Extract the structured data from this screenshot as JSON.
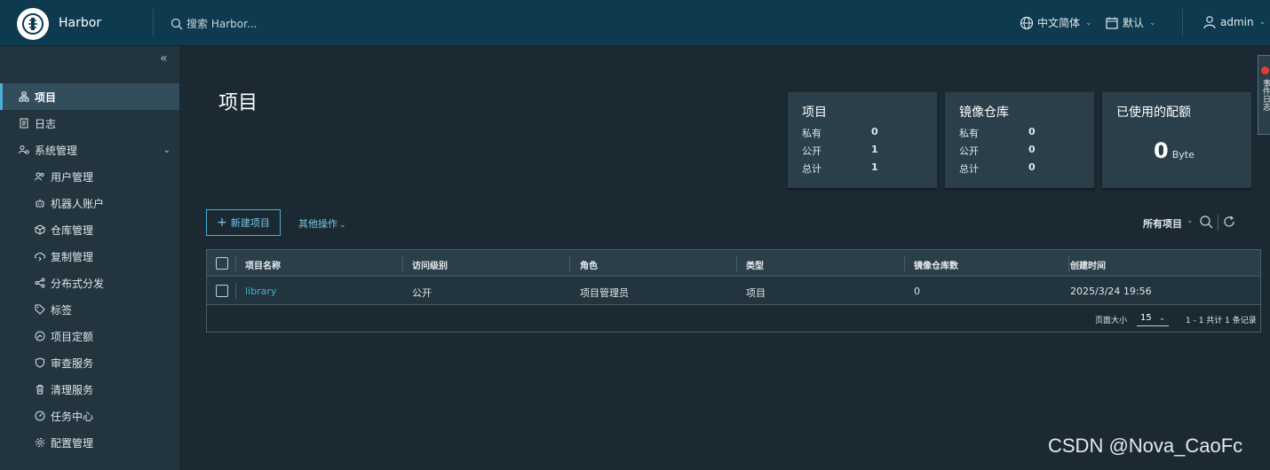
{
  "header": {
    "app_name": "Harbor",
    "search_placeholder": "搜索 Harbor...",
    "language": "中文简体",
    "date_format": "默认",
    "user": "admin"
  },
  "sidebar": {
    "items": [
      {
        "label": "项目",
        "icon": "projects-icon",
        "active": true
      },
      {
        "label": "日志",
        "icon": "log-icon"
      },
      {
        "label": "系统管理",
        "icon": "admin-icon",
        "expandable": true
      },
      {
        "label": "用户管理",
        "icon": "users-icon"
      },
      {
        "label": "机器人账户",
        "icon": "robot-icon"
      },
      {
        "label": "仓库管理",
        "icon": "registry-icon"
      },
      {
        "label": "复制管理",
        "icon": "replication-icon"
      },
      {
        "label": "分布式分发",
        "icon": "share-icon"
      },
      {
        "label": "标签",
        "icon": "tag-icon"
      },
      {
        "label": "项目定额",
        "icon": "quota-icon"
      },
      {
        "label": "审查服务",
        "icon": "shield-icon"
      },
      {
        "label": "清理服务",
        "icon": "trash-icon"
      },
      {
        "label": "任务中心",
        "icon": "dashboard-icon"
      },
      {
        "label": "配置管理",
        "icon": "gear-icon"
      }
    ]
  },
  "main": {
    "title": "项目",
    "cards": {
      "projects": {
        "title": "项目",
        "private_label": "私有",
        "private": "0",
        "public_label": "公开",
        "public": "1",
        "total_label": "总计",
        "total": "1"
      },
      "repos": {
        "title": "镜像仓库",
        "private_label": "私有",
        "private": "0",
        "public_label": "公开",
        "public": "0",
        "total_label": "总计",
        "total": "0"
      },
      "quota": {
        "title": "已使用的配额",
        "value": "0",
        "unit": "Byte"
      }
    },
    "new_project_label": "新建项目",
    "other_actions_label": "其他操作",
    "filter_label": "所有项目",
    "table": {
      "columns": [
        "项目名称",
        "访问级别",
        "角色",
        "类型",
        "镜像仓库数",
        "创建时间"
      ],
      "rows": [
        {
          "name": "library",
          "access": "公开",
          "role": "项目管理员",
          "type": "项目",
          "repo_count": "0",
          "created": "2025/3/24 19:56"
        }
      ],
      "page_size_label": "页面大小",
      "page_size": "15",
      "pagination_info": "1 - 1 共计 1 条记录"
    }
  },
  "rail": {
    "label": "事件日志"
  },
  "watermark": "CSDN @Nova_CaoFc"
}
